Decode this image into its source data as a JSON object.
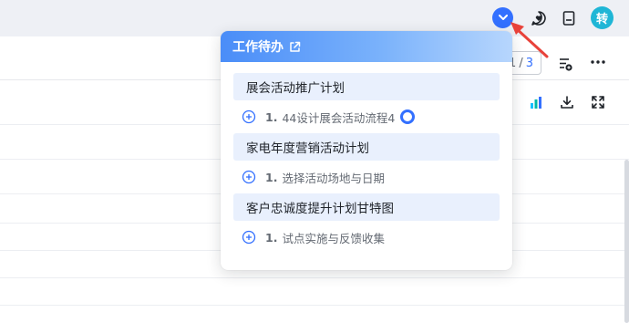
{
  "topbar": {
    "avatar_text": "转",
    "icons": [
      "chevron-down-icon",
      "chat-heart-icon",
      "book-icon"
    ]
  },
  "toolbar": {
    "pager_current": "1",
    "pager_separator": "/",
    "pager_total": "3"
  },
  "todo_popup": {
    "title": "工作待办",
    "groups": [
      {
        "title": "展会活动推广计划",
        "tasks": [
          {
            "index": "1.",
            "text": "44设计展会活动流程4",
            "status": "in-progress"
          }
        ]
      },
      {
        "title": "家电年度营销活动计划",
        "tasks": [
          {
            "index": "1.",
            "text": "选择活动场地与日期"
          }
        ]
      },
      {
        "title": "客户忠诚度提升计划甘特图",
        "tasks": [
          {
            "index": "1.",
            "text": "试点实施与反馈收集"
          }
        ]
      }
    ]
  },
  "colors": {
    "accent": "#3370ff",
    "avatar": "#1fb6d6",
    "arrow": "#e8423a",
    "group_bg": "#e9f0fd"
  }
}
